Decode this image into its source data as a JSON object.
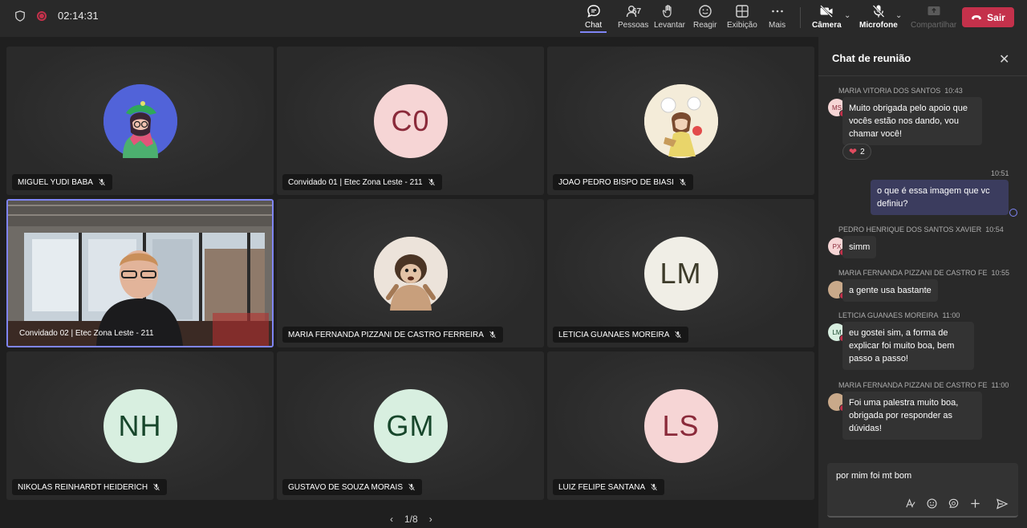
{
  "topbar": {
    "timer": "02:14:31",
    "buttons": [
      {
        "label": "Chat"
      },
      {
        "label": "Pessoas",
        "count": "67"
      },
      {
        "label": "Levantar"
      },
      {
        "label": "Reagir"
      },
      {
        "label": "Exibição"
      },
      {
        "label": "Mais"
      },
      {
        "label": "Câmera"
      },
      {
        "label": "Microfone"
      },
      {
        "label": "Compartilhar"
      }
    ],
    "leave_label": "Sair"
  },
  "tiles": [
    {
      "name": "MIGUEL YUDI BABA",
      "initials": "",
      "avatar_type": "image",
      "color": "#4b5de0"
    },
    {
      "name": "Convidado 01 | Etec Zona Leste - 211",
      "initials": "C0",
      "avatar_type": "initials",
      "bg": "#f6d5d5",
      "fg": "#8a2a3a"
    },
    {
      "name": "JOAO PEDRO BISPO DE BIASI",
      "initials": "",
      "avatar_type": "image",
      "color": "#f3ead8"
    },
    {
      "name": "Convidado 02 | Etec Zona Leste - 211",
      "initials": "",
      "avatar_type": "video"
    },
    {
      "name": "MARIA FERNANDA PIZZANI DE CASTRO FERREIRA",
      "initials": "",
      "avatar_type": "image",
      "color": "#d9c4b5"
    },
    {
      "name": "LETICIA GUANAES MOREIRA",
      "initials": "LM",
      "avatar_type": "initials",
      "bg": "#f0eee6",
      "fg": "#3d3b2a"
    },
    {
      "name": "NIKOLAS REINHARDT HEIDERICH",
      "initials": "NH",
      "avatar_type": "initials",
      "bg": "#d8efe0",
      "fg": "#17462b"
    },
    {
      "name": "GUSTAVO DE SOUZA MORAIS",
      "initials": "GM",
      "avatar_type": "initials",
      "bg": "#d8efe0",
      "fg": "#17462b"
    },
    {
      "name": "LUIZ FELIPE SANTANA",
      "initials": "LS",
      "avatar_type": "initials",
      "bg": "#f6d5d5",
      "fg": "#8a2a3a"
    }
  ],
  "pager": {
    "label": "1/8"
  },
  "chat": {
    "title": "Chat de reunião",
    "messages": [
      {
        "author": "MARIA VITORIA DOS SANTOS",
        "time": "10:43",
        "initials": "MS",
        "text": "Muito obrigada pelo apoio que vocês estão nos dando, vou chamar você!",
        "reaction_count": "2"
      },
      {
        "author": "",
        "time": "10:51",
        "initials": "",
        "text": "o que é essa imagem que vc definiu?"
      },
      {
        "author": "PEDRO HENRIQUE DOS SANTOS XAVIER",
        "time": "10:54",
        "initials": "PX",
        "text": "simm"
      },
      {
        "author": "MARIA FERNANDA PIZZANI DE CASTRO FE",
        "time": "10:55",
        "initials": "",
        "text": "a gente usa bastante"
      },
      {
        "author": "LETICIA GUANAES MOREIRA",
        "time": "11:00",
        "initials": "LM",
        "text": "eu gostei sim, a forma de explicar foi muito boa, bem passo a passo!"
      },
      {
        "author": "MARIA FERNANDA PIZZANI DE CASTRO FE",
        "time": "11:00",
        "initials": "",
        "text": "Foi uma palestra muito boa, obrigada por responder as dúvidas!"
      }
    ],
    "compose_value": "por mim foi mt bom"
  },
  "colors": {
    "accent": "#7f85f5",
    "leave": "#c4314b"
  }
}
